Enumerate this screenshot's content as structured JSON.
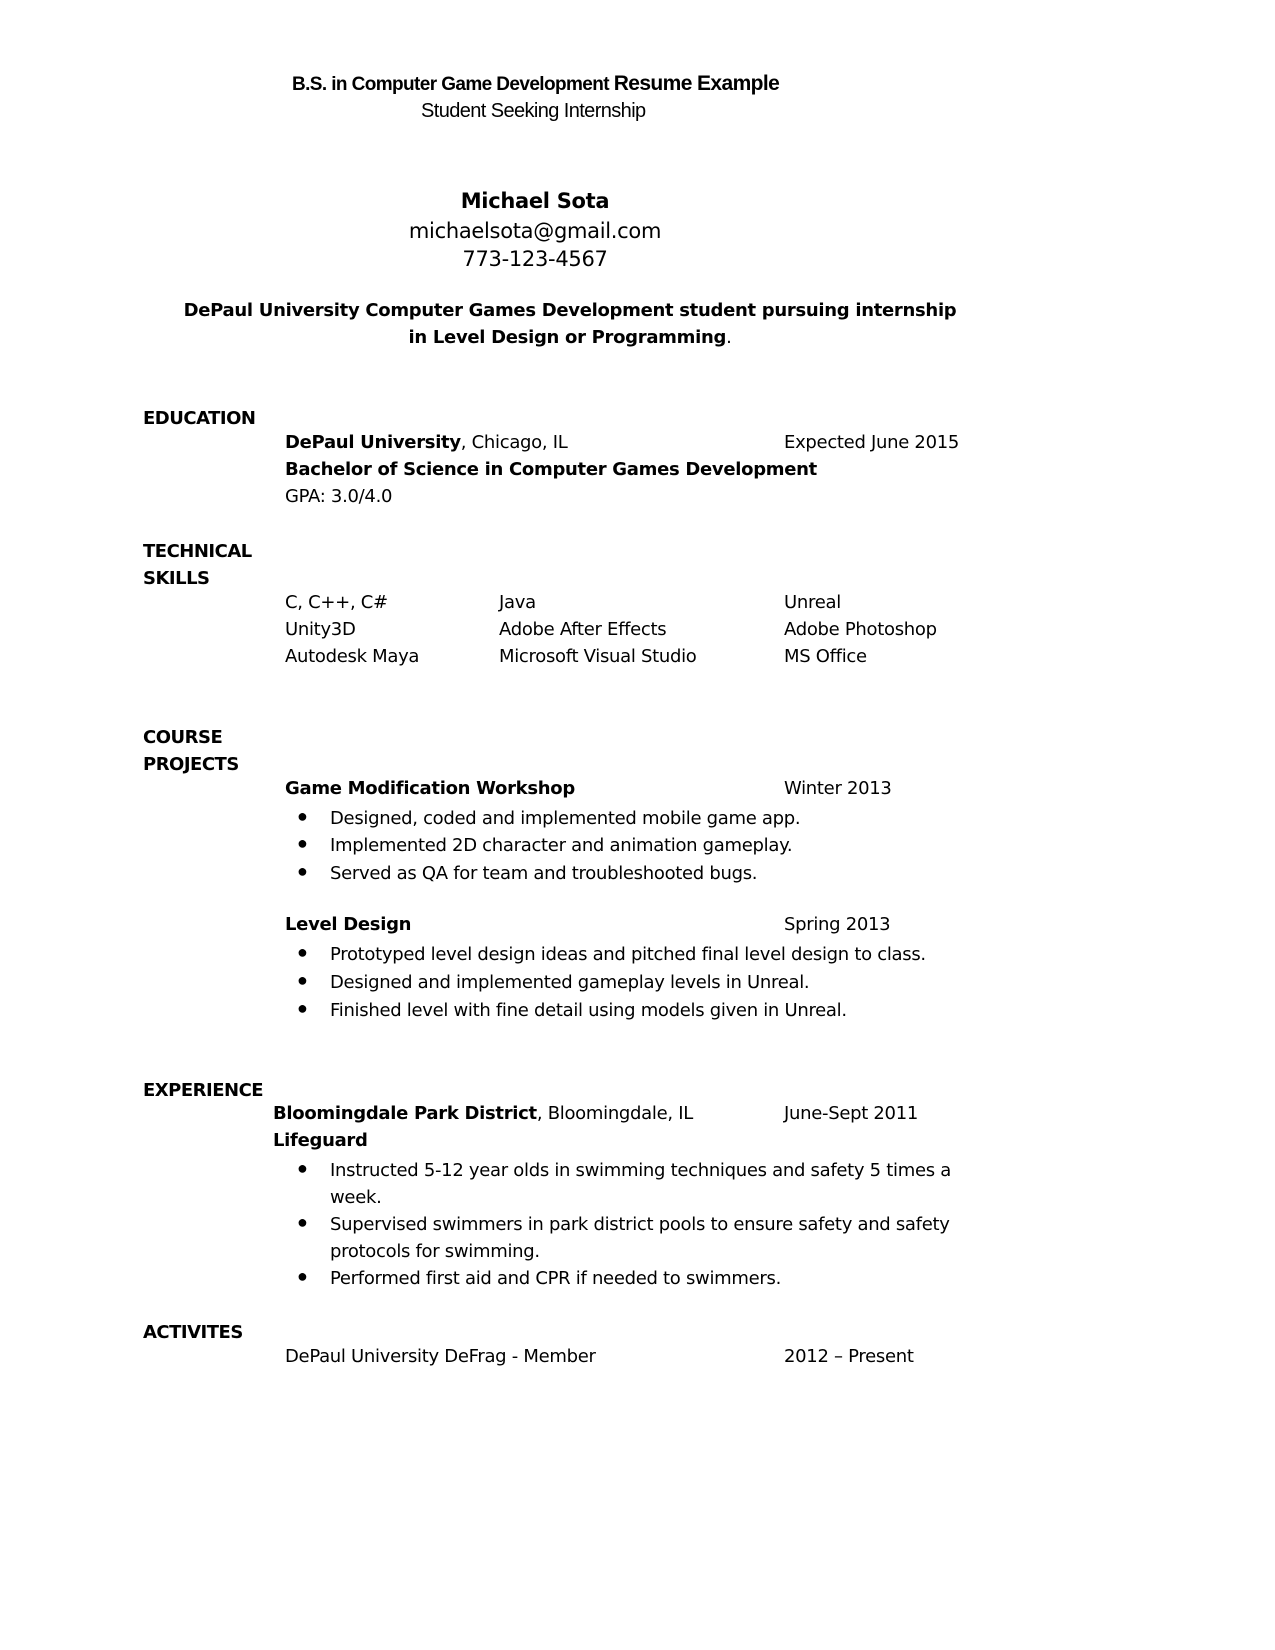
{
  "header": {
    "title_part1": "B.S. in Computer Game Development",
    "title_part2": "Resume Example",
    "subtitle": "Student Seeking Internship"
  },
  "contact": {
    "name": "Michael Sota",
    "email": "michaelsota@gmail.com",
    "phone": "773-123-4567"
  },
  "objective": {
    "line1": "DePaul University Computer Games Development student pursuing internship",
    "line2": "in Level Design or Programming",
    "line2_end": "."
  },
  "education": {
    "heading": "EDUCATION",
    "school": "DePaul University",
    "location": ", Chicago, IL",
    "date": "Expected June 2015",
    "degree": "Bachelor of Science in Computer Games Development",
    "gpa": "GPA: 3.0/4.0"
  },
  "skills": {
    "heading_line1": "TECHNICAL",
    "heading_line2": "SKILLS",
    "rows": [
      [
        "C, C++, C#",
        "Java",
        "Unreal"
      ],
      [
        "Unity3D",
        "Adobe After Effects",
        "Adobe Photoshop"
      ],
      [
        "Autodesk Maya",
        "Microsoft Visual Studio",
        "MS Office"
      ]
    ]
  },
  "projects": {
    "heading_line1": "COURSE",
    "heading_line2": "PROJECTS",
    "items": [
      {
        "title": "Game Modification Workshop",
        "date": "Winter 2013",
        "bullets": [
          "Designed, coded and implemented mobile game app.",
          "Implemented 2D character and animation gameplay.",
          "Served as QA for team and troubleshooted bugs."
        ]
      },
      {
        "title": "Level Design",
        "date": "Spring 2013",
        "bullets": [
          "Prototyped level design ideas and pitched final level design to class.",
          "Designed and implemented gameplay levels in Unreal.",
          "Finished level with fine detail using models given in Unreal."
        ]
      }
    ]
  },
  "experience": {
    "heading": "EXPERIENCE",
    "employer": "Bloomingdale Park District",
    "location": ", Bloomingdale, IL",
    "date": "June-Sept 2011",
    "role": "Lifeguard",
    "bullets": [
      {
        "line1": "Instructed 5-12 year olds in swimming techniques and safety 5 times a",
        "line2": "week."
      },
      {
        "line1": "Supervised swimmers in park district pools to ensure safety and safety",
        "line2": "protocols for swimming."
      },
      {
        "line1": "Performed first aid and CPR if needed to swimmers.",
        "line2": ""
      }
    ]
  },
  "activities": {
    "heading": "ACTIVITES",
    "item": "DePaul University DeFrag - Member",
    "date": "2012 – Present"
  }
}
